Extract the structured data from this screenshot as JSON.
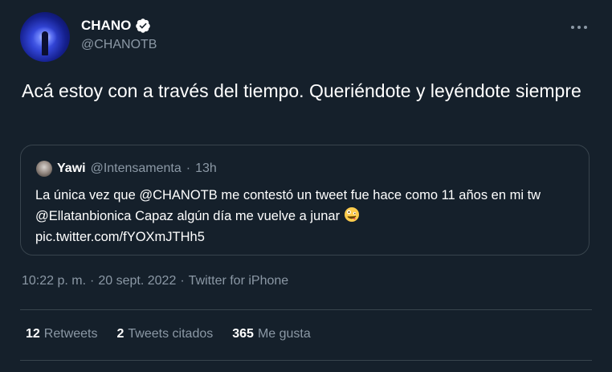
{
  "author": {
    "display_name": "CHANO",
    "handle": "@CHANOTB",
    "verified": true
  },
  "tweet": {
    "text": "Acá estoy con a través del tiempo. Queriéndote y leyéndote siempre"
  },
  "quoted": {
    "display_name": "Yawi",
    "handle": "@Intensamenta",
    "separator": "·",
    "time": "13h",
    "text": "La única vez que @CHANOTB me contestó un tweet fue hace como 11 años en mi tw @Ellatanbionica Capaz algún día me vuelve a junar",
    "link": "pic.twitter.com/fYOXmJTHh5"
  },
  "meta": {
    "time": "10:22 p. m.",
    "separator1": "·",
    "date": "20 sept. 2022",
    "separator2": "·",
    "source": "Twitter for iPhone"
  },
  "stats": {
    "retweets_count": "12",
    "retweets_label": "Retweets",
    "quotes_count": "2",
    "quotes_label": "Tweets citados",
    "likes_count": "365",
    "likes_label": "Me gusta"
  },
  "colors": {
    "background": "#15202b",
    "text_primary": "#ffffff",
    "text_secondary": "#8b98a5",
    "border": "#38444d",
    "verified_badge": "#ffffff"
  },
  "icons": {
    "verified": "verified-badge-icon",
    "more": "more-options-icon",
    "emoji": "zany-face-emoji-icon"
  }
}
